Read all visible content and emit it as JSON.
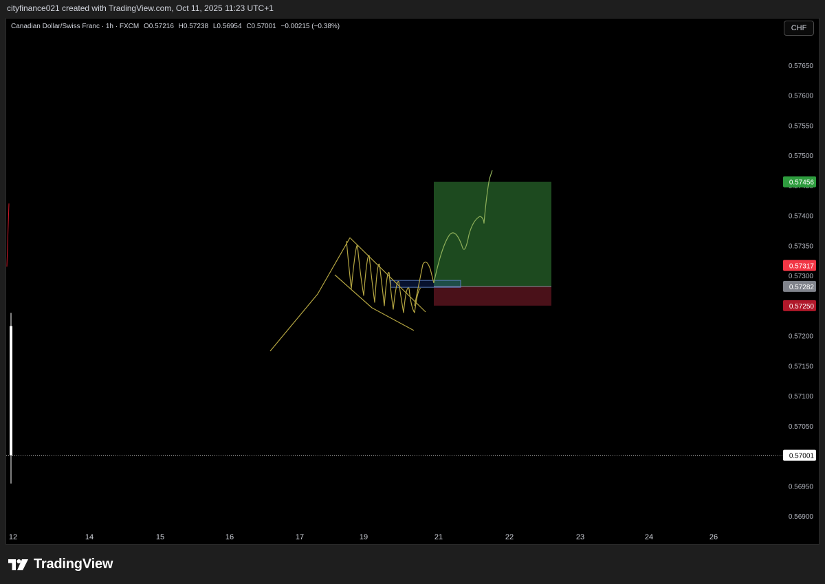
{
  "header": {
    "attribution": "cityfinance021 created with TradingView.com, Oct 11, 2025 11:23 UTC+1"
  },
  "legend": {
    "symbol": "Canadian Dollar/Swiss Franc · 1h · FXCM",
    "open": "O0.57216",
    "high": "H0.57238",
    "low": "L0.56954",
    "close": "C0.57001",
    "change": "−0.00215 (−0.38%)"
  },
  "currency_button": "CHF",
  "brand": {
    "name": "TradingView"
  },
  "colors": {
    "background": "#000000",
    "drawing": "#b5a642",
    "target_zone": "#1d4a1f",
    "stop_zone": "#4a1119",
    "target_label": "#2e9c3e",
    "stop_label": "#b0182a",
    "red_label": "#f23645",
    "entry_label": "#80838b"
  },
  "chart_data": {
    "type": "candlestick",
    "instrument": "Canadian Dollar/Swiss Franc",
    "interval": "1h",
    "source": "FXCM",
    "x_ticks": [
      "12",
      "14",
      "15",
      "16",
      "17",
      "19",
      "21",
      "22",
      "23",
      "24",
      "26"
    ],
    "y_ticks": [
      "0.57650",
      "0.57600",
      "0.57550",
      "0.57500",
      "0.57450",
      "0.57400",
      "0.57350",
      "0.57300",
      "0.57250",
      "0.57200",
      "0.57150",
      "0.57100",
      "0.57050",
      "0.57000",
      "0.56950",
      "0.56900"
    ],
    "ylim": [
      0.5687,
      0.57695
    ],
    "last_price": 0.57001,
    "last_candle": {
      "open": 0.57216,
      "high": 0.57238,
      "low": 0.56954,
      "close": 0.57001
    },
    "position": {
      "target": 0.57456,
      "entry": 0.57282,
      "stop": 0.5725
    },
    "price_labels": [
      {
        "text": "0.57456",
        "value": 0.57456,
        "role": "target"
      },
      {
        "text": "0.57317",
        "value": 0.57317,
        "role": "red"
      },
      {
        "text": "0.57282",
        "value": 0.57282,
        "role": "entry"
      },
      {
        "text": "0.57250",
        "value": 0.5725,
        "role": "stop"
      },
      {
        "text": "0.57001",
        "value": 0.57001,
        "role": "last"
      }
    ],
    "grid": false
  }
}
